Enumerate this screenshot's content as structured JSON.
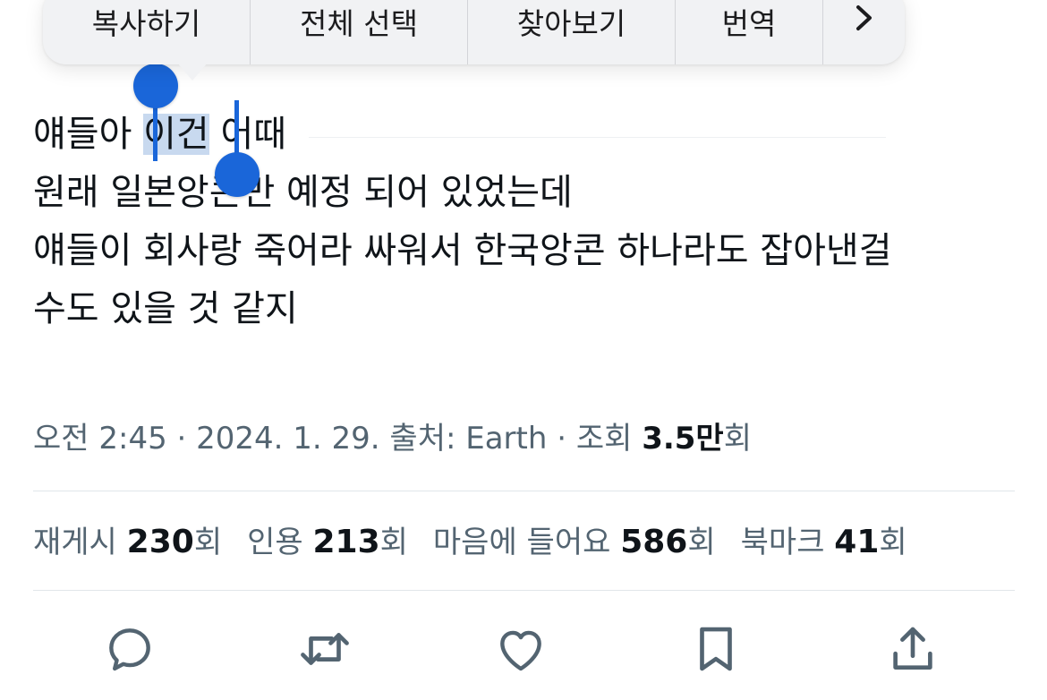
{
  "context_menu": {
    "items": [
      "복사하기",
      "전체 선택",
      "찾아보기",
      "번역"
    ],
    "more_icon": "chevron-right-icon"
  },
  "tweet": {
    "line1_before": "얘들아 ",
    "line1_selected": "이건",
    "line1_after": " 어때",
    "line2": "원래 일본앙콘만 예정 되어 있었는데",
    "line3": "얘들이 회사랑 죽어라 싸워서 한국앙콘 하나라도 잡아낸걸",
    "line4": "수도 있을 것 같지"
  },
  "meta": {
    "prefix": "오전 2:45 · 2024. 1. 29. 출처: Earth · 조회 ",
    "views": "3.5만",
    "suffix": "회"
  },
  "stats": [
    {
      "label": "재게시 ",
      "value": "230",
      "unit": "회"
    },
    {
      "label": "인용 ",
      "value": "213",
      "unit": "회"
    },
    {
      "label": "마음에 들어요 ",
      "value": "586",
      "unit": "회"
    },
    {
      "label": "북마크 ",
      "value": "41",
      "unit": "회"
    }
  ],
  "actions": [
    "reply-icon",
    "retweet-icon",
    "like-icon",
    "bookmark-icon",
    "share-icon"
  ],
  "colors": {
    "text": "#0f1419",
    "secondary": "#536471",
    "selection_handle": "#1a66d9",
    "selection_fill": "#c8d9ef",
    "menu_bg": "#f1f2f4"
  }
}
